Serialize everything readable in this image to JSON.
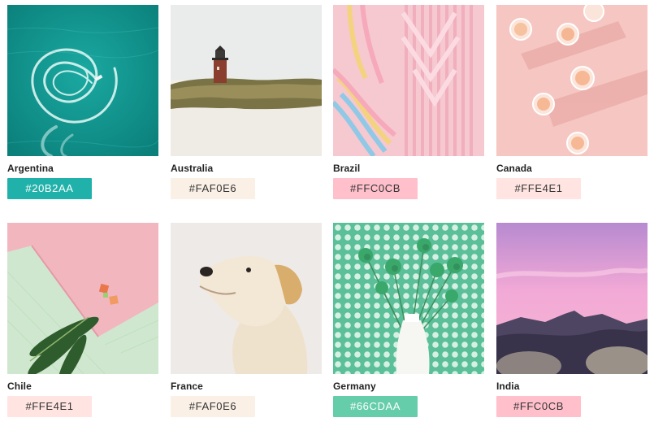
{
  "palette": {
    "items": [
      {
        "country": "Argentina",
        "hex": "#20B2AA",
        "color": "#20B2AA",
        "image": "aerial-ocean-boat-wake"
      },
      {
        "country": "Australia",
        "hex": "#FAF0E6",
        "color": "#FAF0E6",
        "image": "lighthouse-sand-dune"
      },
      {
        "country": "Brazil",
        "hex": "#FFC0CB",
        "color": "#FFC0CB",
        "image": "pink-macrame-weaving"
      },
      {
        "country": "Canada",
        "hex": "#FFE4E1",
        "color": "#FFE4E1",
        "image": "pink-drinks-shadows"
      },
      {
        "country": "Chile",
        "hex": "#FFE4E1",
        "color": "#FFE4E1",
        "image": "leaves-on-pink-paper"
      },
      {
        "country": "France",
        "hex": "#FAF0E6",
        "color": "#FAF0E6",
        "image": "white-dog-portrait"
      },
      {
        "country": "Germany",
        "hex": "#66CDAA",
        "color": "#66CDAA",
        "image": "green-flowers-vase"
      },
      {
        "country": "India",
        "hex": "#FFC0CB",
        "color": "#FFC0CB",
        "image": "pink-sunset-mountains"
      }
    ]
  }
}
